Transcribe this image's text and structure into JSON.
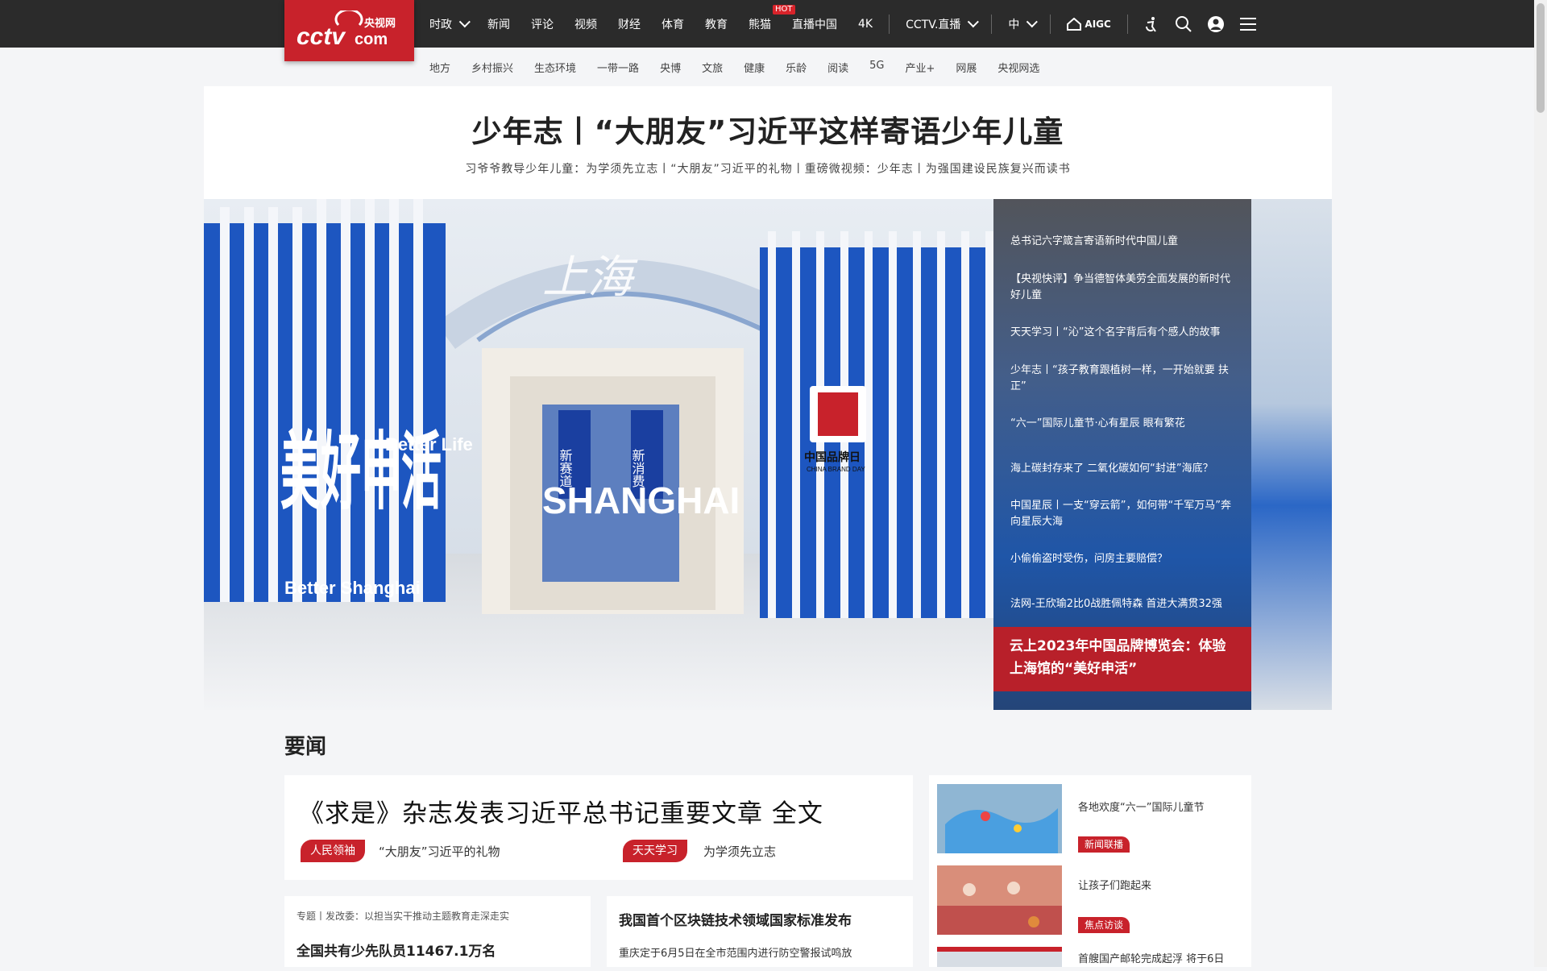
{
  "brand": {
    "logo_text": "CCTV.com",
    "logo_cn": "央视网"
  },
  "nav": {
    "items": [
      {
        "label": "时政",
        "chev": true
      },
      {
        "label": "新闻"
      },
      {
        "label": "评论"
      },
      {
        "label": "视频"
      },
      {
        "label": "财经"
      },
      {
        "label": "体育"
      },
      {
        "label": "教育"
      },
      {
        "label": "熊猫",
        "hot": "HOT"
      },
      {
        "label": "直播中国"
      },
      {
        "label": "4K"
      }
    ],
    "live": "CCTV.直播",
    "lang": "中",
    "aigc": "AIGC"
  },
  "subnav": [
    "地方",
    "乡村振兴",
    "生态环境",
    "一带一路",
    "央博",
    "文旅",
    "健康",
    "乐龄",
    "阅读",
    "5G",
    "产业+",
    "网展",
    "央视网选"
  ],
  "hero": {
    "title": "少年志丨“大朋友”习近平这样寄语少年儿童",
    "subtitle": "习爷爷教导少年儿童：为学须先立志丨“大朋友”习近平的礼物丨重磅微视频：少年志丨为强国建设民族复兴而读书",
    "list": [
      "总书记六字箴言寄语新时代中国儿童",
      "【央视快评】争当德智体美劳全面发展的新时代好儿童",
      "天天学习丨“沁”这个名字背后有个感人的故事",
      "少年志丨“孩子教育跟植树一样，一开始就要 扶正”",
      "“六一”国际儿童节·心有星辰 眼有繁花",
      "海上碳封存来了 二氧化碳如何“封进”海底？",
      "中国星辰丨一支“穿云箭”，如何带“千军万马”奔向星辰大海",
      "小偷偷盗时受伤，问房主要赔偿？",
      "法网-王欣瑜2比0战胜佩特森 首进大满贯32强"
    ],
    "feature": "云上2023年中国品牌博览会：体验上海馆的“美好申活”",
    "image_text": {
      "big": "美好申活",
      "better1": "Better Life",
      "better2": "Better Shanghai",
      "shanghai": "SHANGHAI",
      "sign1": "新赛道",
      "sign2": "新消费",
      "brand_day": "中国品牌日",
      "brand_day_en": "CHINA BRAND DAY"
    }
  },
  "news": {
    "section_title": "要闻",
    "headline": "《求是》杂志发表习近平总书记重要文章 全文",
    "tag1": "人民领袖",
    "tag1_text": "“大朋友”习近平的礼物",
    "tag2": "天天学习",
    "tag2_text": "为学须先立志",
    "card_left": {
      "kicker": "专题丨发改委：以担当实干推动主题教育走深走实",
      "title": "全国共有少先队员11467.1万名"
    },
    "card_right": {
      "title": "我国首个区块链技术领域国家标准发布",
      "text": "重庆定于6月5日在全市范围内进行防空警报试鸣放"
    },
    "side": [
      {
        "title": "各地欢度“六一”国际儿童节",
        "tag": "新闻联播"
      },
      {
        "title": "让孩子们跑起来",
        "tag": "焦点访谈"
      },
      {
        "title": "首艘国产邮轮完成起浮 将于6日"
      }
    ]
  },
  "colors": {
    "brand_red": "#c8222b",
    "topbar": "#2b2b2b"
  }
}
